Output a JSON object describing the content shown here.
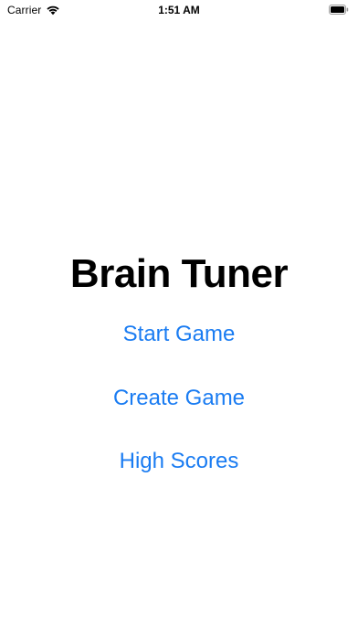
{
  "status_bar": {
    "carrier": "Carrier",
    "time": "1:51 AM",
    "wifi_icon": "wifi-icon",
    "battery_icon": "battery-icon"
  },
  "main": {
    "title": "Brain Tuner",
    "buttons": {
      "start_game": "Start Game",
      "create_game": "Create Game",
      "high_scores": "High Scores"
    }
  },
  "colors": {
    "accent": "#1a7cf2",
    "background": "#ffffff",
    "text": "#000000"
  }
}
